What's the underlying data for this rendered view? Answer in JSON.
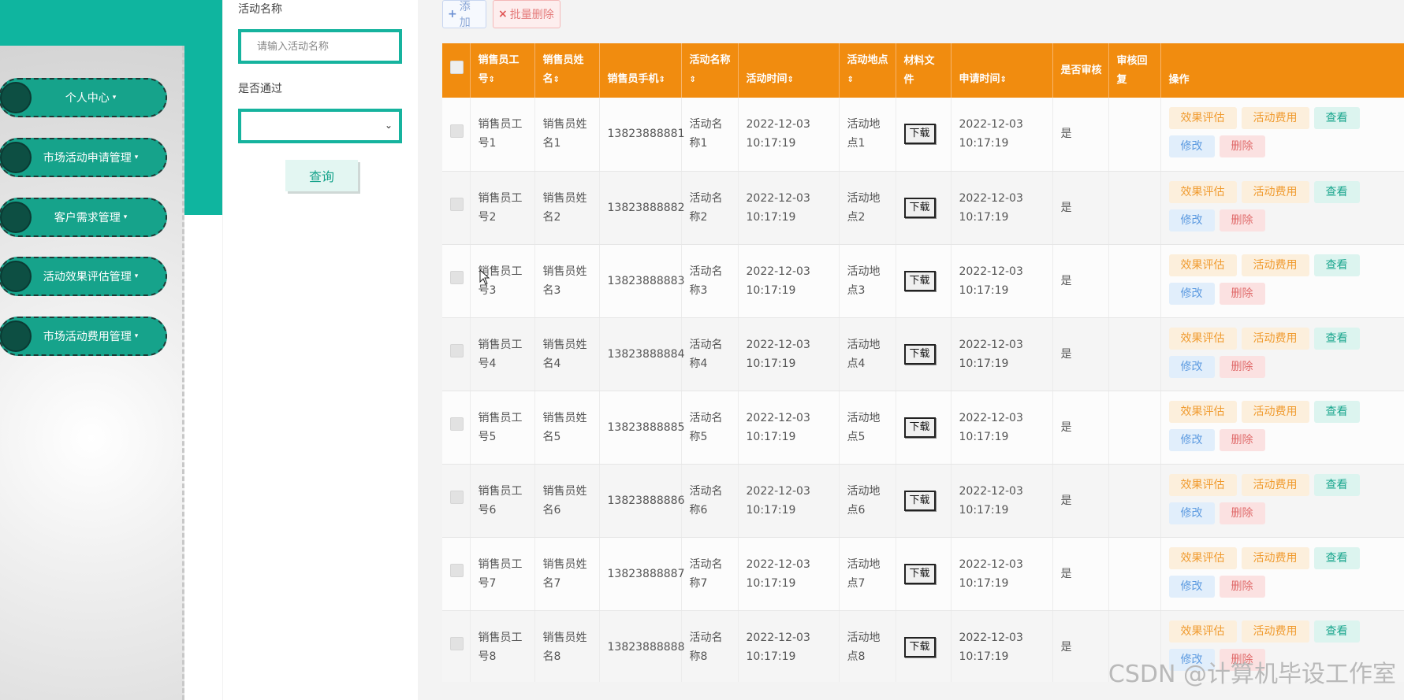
{
  "sidebar": {
    "items": [
      {
        "label": "个人中心"
      },
      {
        "label": "市场活动申请管理"
      },
      {
        "label": "客户需求管理"
      },
      {
        "label": "活动效果评估管理"
      },
      {
        "label": "市场活动费用管理"
      }
    ],
    "caret": "▾"
  },
  "search": {
    "name_label": "活动名称",
    "name_placeholder": "请输入活动名称",
    "name_value": "",
    "pass_label": "是否通过",
    "pass_selected": "",
    "query_label": "查询"
  },
  "toolbar": {
    "add_icon": "+",
    "add_label": "添加",
    "batch_delete_icon": "×",
    "batch_delete_label": "批量删除"
  },
  "table": {
    "headers": [
      {
        "label": "销售员工号"
      },
      {
        "label": "销售员姓名"
      },
      {
        "label": "销售员手机"
      },
      {
        "label": "活动名称"
      },
      {
        "label": "活动时间"
      },
      {
        "label": "活动地点"
      },
      {
        "label": "材料文件"
      },
      {
        "label": "申请时间"
      },
      {
        "label": "是否审核"
      },
      {
        "label": "审核回复"
      },
      {
        "label": "操作"
      }
    ],
    "sort_glyph": "⇕",
    "download_label": "下载",
    "actions": {
      "eval": "效果评估",
      "cost": "活动费用",
      "view": "查看",
      "edit": "修改",
      "delete": "删除"
    },
    "rows": [
      {
        "emp_no": "销售员工号1",
        "emp_name": "销售员姓名1",
        "phone": "13823888881",
        "act_name": "活动名称1",
        "act_time": "2022-12-03 10:17:19",
        "place": "活动地点1",
        "apply_time": "2022-12-03 10:17:19",
        "audited": "是",
        "reply": ""
      },
      {
        "emp_no": "销售员工号2",
        "emp_name": "销售员姓名2",
        "phone": "13823888882",
        "act_name": "活动名称2",
        "act_time": "2022-12-03 10:17:19",
        "place": "活动地点2",
        "apply_time": "2022-12-03 10:17:19",
        "audited": "是",
        "reply": ""
      },
      {
        "emp_no": "销售员工号3",
        "emp_name": "销售员姓名3",
        "phone": "13823888883",
        "act_name": "活动名称3",
        "act_time": "2022-12-03 10:17:19",
        "place": "活动地点3",
        "apply_time": "2022-12-03 10:17:19",
        "audited": "是",
        "reply": ""
      },
      {
        "emp_no": "销售员工号4",
        "emp_name": "销售员姓名4",
        "phone": "13823888884",
        "act_name": "活动名称4",
        "act_time": "2022-12-03 10:17:19",
        "place": "活动地点4",
        "apply_time": "2022-12-03 10:17:19",
        "audited": "是",
        "reply": ""
      },
      {
        "emp_no": "销售员工号5",
        "emp_name": "销售员姓名5",
        "phone": "13823888885",
        "act_name": "活动名称5",
        "act_time": "2022-12-03 10:17:19",
        "place": "活动地点5",
        "apply_time": "2022-12-03 10:17:19",
        "audited": "是",
        "reply": ""
      },
      {
        "emp_no": "销售员工号6",
        "emp_name": "销售员姓名6",
        "phone": "13823888886",
        "act_name": "活动名称6",
        "act_time": "2022-12-03 10:17:19",
        "place": "活动地点6",
        "apply_time": "2022-12-03 10:17:19",
        "audited": "是",
        "reply": ""
      },
      {
        "emp_no": "销售员工号7",
        "emp_name": "销售员姓名7",
        "phone": "13823888887",
        "act_name": "活动名称7",
        "act_time": "2022-12-03 10:17:19",
        "place": "活动地点7",
        "apply_time": "2022-12-03 10:17:19",
        "audited": "是",
        "reply": ""
      },
      {
        "emp_no": "销售员工号8",
        "emp_name": "销售员姓名8",
        "phone": "13823888888",
        "act_name": "活动名称8",
        "act_time": "2022-12-03 10:17:19",
        "place": "活动地点8",
        "apply_time": "2022-12-03 10:17:19",
        "audited": "是",
        "reply": ""
      }
    ]
  },
  "watermark": "CSDN @计算机毕设工作室",
  "colors": {
    "accent_teal": "#0fb59f",
    "header_orange": "#f18c0f",
    "menu_green": "#16a38b"
  }
}
